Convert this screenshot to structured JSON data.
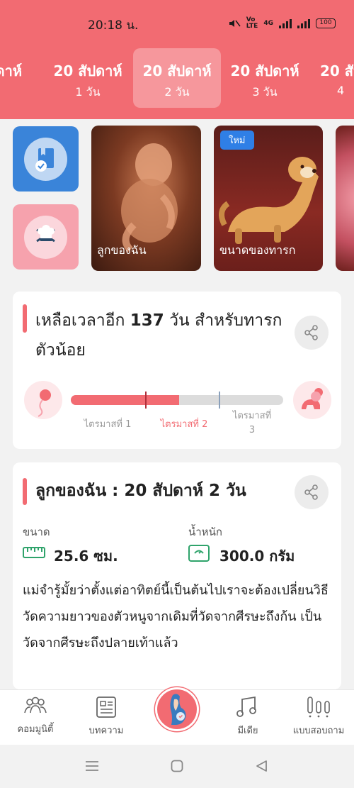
{
  "status_bar": {
    "time": "20:18 น.",
    "network": "4G",
    "battery": "100"
  },
  "day_tabs": [
    {
      "week": "ปดาห์",
      "day": ""
    },
    {
      "week": "20 สัปดาห์",
      "day": "1 วัน"
    },
    {
      "week": "20 สัปดาห์",
      "day": "2 วัน",
      "active": true
    },
    {
      "week": "20 สัปดาห์",
      "day": "3 วัน"
    },
    {
      "week": "20 สัป",
      "day": "4"
    }
  ],
  "features": {
    "baby_card_label": "ลูกของฉัน",
    "size_card_label": "ขนาดของทารก",
    "new_badge": "ใหม่"
  },
  "countdown": {
    "prefix": "เหลือเวลาอีก ",
    "days": "137",
    "suffix": " วัน สำหรับทารกตัวน้อย",
    "progress": 0.51,
    "trimester_1": "ไตรมาสที่ 1",
    "trimester_2": "ไตรมาสที่ 2",
    "trimester_3_line1": "ไตรมาสที่",
    "trimester_3_line2": "3"
  },
  "baby_info": {
    "title": "ลูกของฉัน : 20 สัปดาห์ 2  วัน",
    "size_label": "ขนาด",
    "size_value": "25.6 ซม.",
    "weight_label": "น้ำหนัก",
    "weight_value": "300.0 กรัม",
    "description": "แม่จำรู้มั้ยว่าตั้งแต่อาทิตย์นี้เป็นต้นไปเราจะต้องเปลี่ยนวิธีวัดความยาวของตัวหนูจากเดิมที่วัดจากศีรษะถึงก้น เป็นวัดจากศีรษะถึงปลายเท้าแล้ว"
  },
  "bottom_nav": {
    "community": "คอมมูนิตี้",
    "articles": "บทความ",
    "media": "มีเดีย",
    "quiz": "แบบสอบถาม"
  },
  "colors": {
    "brand": "#f26b72",
    "blue": "#3a84d9",
    "pink": "#f6a2ad"
  }
}
